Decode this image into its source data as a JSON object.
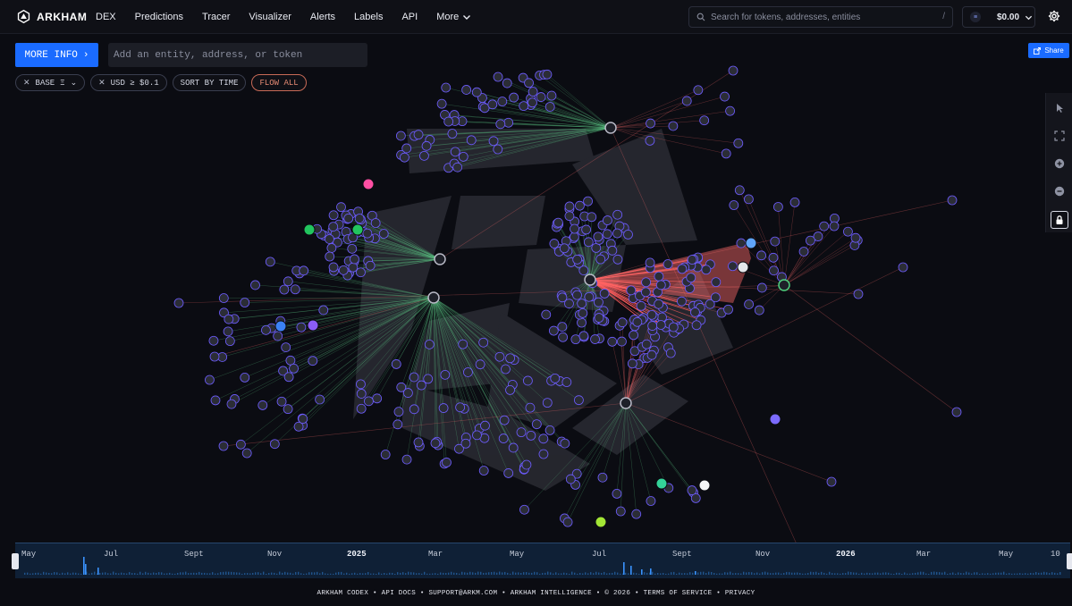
{
  "brand": {
    "name": "ARKHAM"
  },
  "nav": {
    "items": [
      "DEX",
      "Predictions",
      "Tracer",
      "Visualizer",
      "Alerts",
      "Labels",
      "API"
    ],
    "more": "More"
  },
  "search": {
    "placeholder": "Search for tokens, addresses, entities",
    "shortcut": "/"
  },
  "wallet": {
    "balance": "$0.00",
    "coin_glyph": "≡"
  },
  "graph_controls": {
    "more_info": "MORE INFO",
    "entity_placeholder": "Add an entity, address, or token",
    "share": "Share",
    "chips": {
      "base": "BASE",
      "base_symbol": "Ξ",
      "usd": "USD ≥ $0.1",
      "sort": "SORT BY TIME",
      "flow": "FLOW ALL"
    }
  },
  "timeline": {
    "labels": [
      "May",
      "Jul",
      "Sept",
      "Nov",
      "2025",
      "Mar",
      "May",
      "Jul",
      "Sept",
      "Nov",
      "2026",
      "Mar",
      "May",
      "10"
    ],
    "bold_labels": [
      "2025",
      "2026"
    ]
  },
  "footer": {
    "items": [
      "ARKHAM CODEX",
      "API DOCS",
      "SUPPORT@ARKM.COM",
      "ARKHAM INTELLIGENCE",
      "© 2026",
      "TERMS OF SERVICE",
      "PRIVACY"
    ],
    "separator": "•"
  },
  "colors": {
    "accent": "#1a6bff",
    "background": "#0b0c12",
    "inflow_edge": "#5fd08a",
    "outflow_edge": "#ff5c5c",
    "node_ring": "#6d5cff"
  },
  "icons": [
    "arkham-logo-icon",
    "chevron-down-icon",
    "search-icon",
    "gear-icon",
    "share-icon",
    "cursor-icon",
    "fit-view-icon",
    "zoom-in-icon",
    "zoom-out-icon",
    "lock-icon",
    "close-icon"
  ]
}
